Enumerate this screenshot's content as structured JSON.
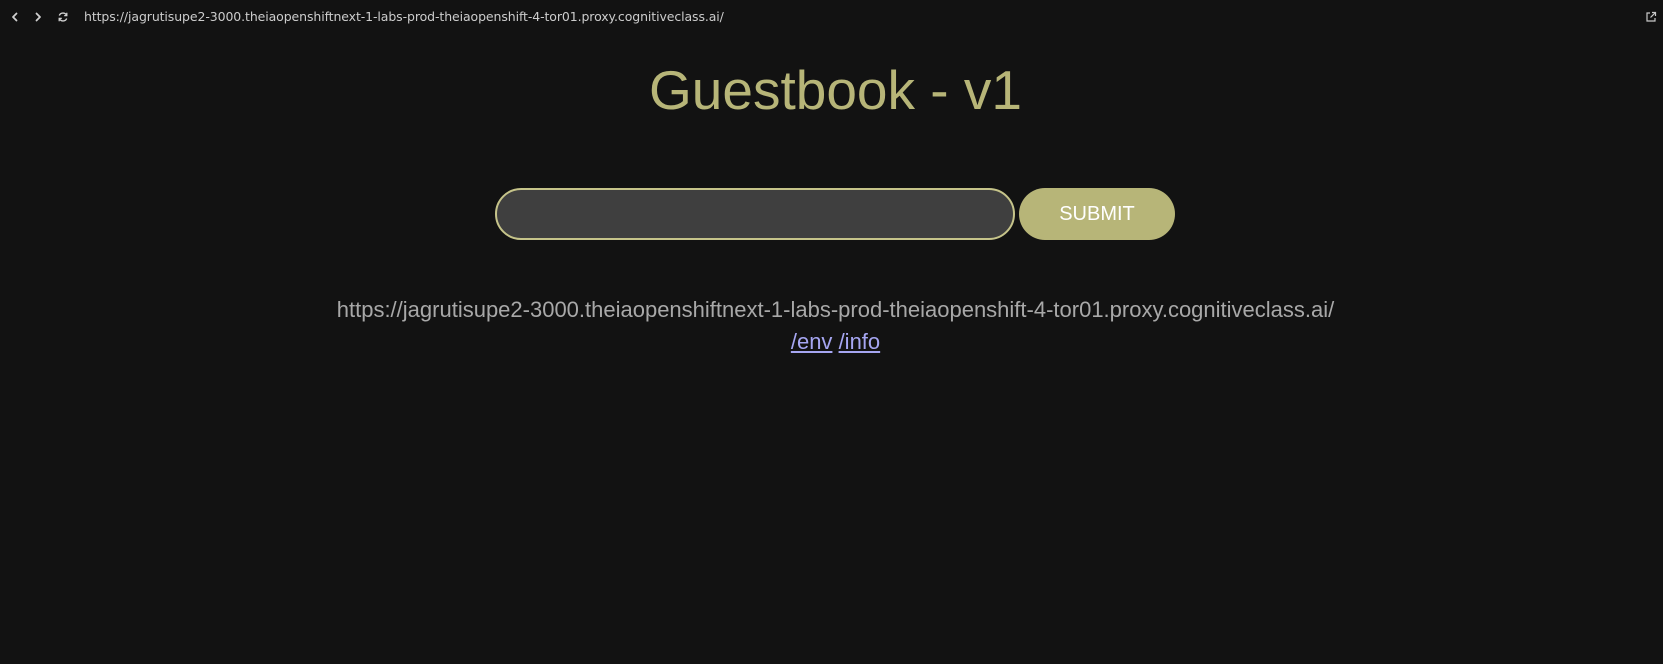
{
  "browser": {
    "url": "https://jagrutisupe2-3000.theiaopenshiftnext-1-labs-prod-theiaopenshift-4-tor01.proxy.cognitiveclass.ai/",
    "icons": {
      "back": "chevron-left-icon",
      "forward": "chevron-right-icon",
      "reload": "refresh-icon",
      "external": "external-link-icon"
    }
  },
  "page": {
    "title": "Guestbook - v1",
    "form": {
      "input_value": "",
      "submit_label": "SUBMIT"
    },
    "host_url": "https://jagrutisupe2-3000.theiaopenshiftnext-1-labs-prod-theiaopenshift-4-tor01.proxy.cognitiveclass.ai/",
    "links": {
      "env": "/env",
      "info": "/info"
    }
  },
  "colors": {
    "background": "#121212",
    "accent": "#b7b578",
    "input_background": "#3f3f3f",
    "host_text": "#a8a8a8",
    "link": "#a6a6f2"
  }
}
